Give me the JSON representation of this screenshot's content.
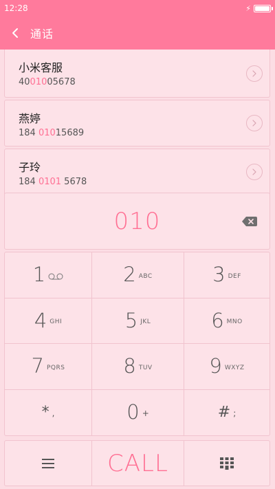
{
  "status_bar": {
    "time": "12:28"
  },
  "header": {
    "title": "通话"
  },
  "contacts": [
    {
      "name": "小米客服",
      "number_pre": "40",
      "number_match": "010",
      "number_post": "05678"
    },
    {
      "name": "燕婷",
      "number_pre": "184 ",
      "number_match": "010",
      "number_post": "15689"
    },
    {
      "name": "子玲",
      "number_pre": "184 ",
      "number_match": "0101",
      "number_post": " 5678"
    }
  ],
  "dial_input": {
    "value": "010"
  },
  "keypad": [
    {
      "digit": "1",
      "letters": ""
    },
    {
      "digit": "2",
      "letters": "ABC"
    },
    {
      "digit": "3",
      "letters": "DEF"
    },
    {
      "digit": "4",
      "letters": "GHI"
    },
    {
      "digit": "5",
      "letters": "JKL"
    },
    {
      "digit": "6",
      "letters": "MNO"
    },
    {
      "digit": "7",
      "letters": "PQRS"
    },
    {
      "digit": "8",
      "letters": "TUV"
    },
    {
      "digit": "9",
      "letters": "WXYZ"
    },
    {
      "digit": "*",
      "letters": ","
    },
    {
      "digit": "0",
      "letters": "+"
    },
    {
      "digit": "#",
      "letters": ";"
    }
  ],
  "bottom": {
    "call_label": "CALL"
  },
  "icons": {
    "back": "chevron-left-icon",
    "detail": "chevron-right-circle-icon",
    "backspace": "backspace-icon",
    "voicemail": "voicemail-icon",
    "menu": "menu-icon",
    "dialpad": "dialpad-grid-icon",
    "charging": "lightning-icon",
    "battery": "battery-icon"
  },
  "colors": {
    "accent": "#ff7a9c",
    "highlight": "#ff6f93",
    "panel": "#fde2e8",
    "border": "#f1c3ce"
  }
}
